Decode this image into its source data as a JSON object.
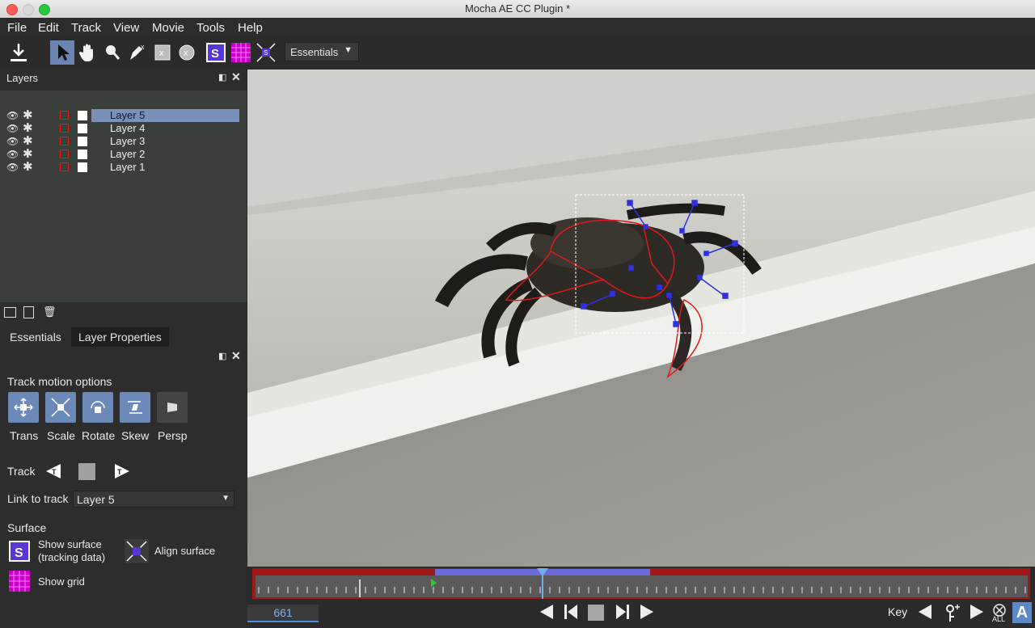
{
  "window": {
    "title": "Mocha AE CC Plugin *"
  },
  "menu": [
    "File",
    "Edit",
    "Track",
    "View",
    "Movie",
    "Tools",
    "Help"
  ],
  "toolbar": {
    "workspace": "Essentials"
  },
  "layers_panel": {
    "title": "Layers",
    "layers": [
      {
        "name": "Layer 5",
        "selected": true
      },
      {
        "name": "Layer 4",
        "selected": false
      },
      {
        "name": "Layer 3",
        "selected": false
      },
      {
        "name": "Layer 2",
        "selected": false
      },
      {
        "name": "Layer 1",
        "selected": false
      }
    ]
  },
  "tabs": {
    "essentials": "Essentials",
    "layer_properties": "Layer Properties"
  },
  "track_motion": {
    "heading": "Track motion options",
    "options": [
      "Trans",
      "Scale",
      "Rotate",
      "Skew",
      "Persp"
    ]
  },
  "track": {
    "label": "Track"
  },
  "link_to_track": {
    "label": "Link to track",
    "value": "Layer 5"
  },
  "surface": {
    "heading": "Surface",
    "show_surface_line1": "Show surface",
    "show_surface_line2": "(tracking data)",
    "align_surface": "Align surface",
    "show_grid": "Show grid"
  },
  "timeline": {
    "frame": "661",
    "key_label": "Key",
    "all_label": "ALL"
  },
  "colors": {
    "accent_blue": "#4a8fe2",
    "selection": "#7990b8",
    "spline_red": "#e31818",
    "tracker_blue": "#3030e0",
    "surface_purple": "#5a36d6",
    "grid_magenta": "#c800c8"
  }
}
